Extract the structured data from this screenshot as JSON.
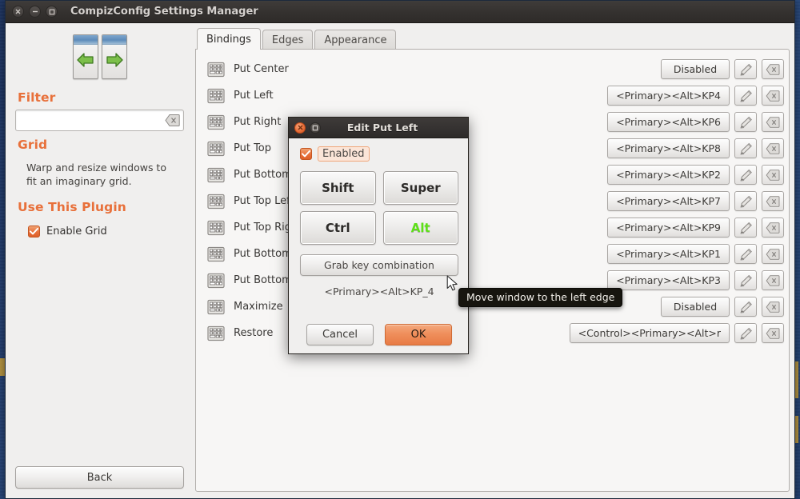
{
  "window": {
    "title": "CompizConfig Settings Manager",
    "controls": [
      {
        "name": "close",
        "glyph": "×"
      },
      {
        "name": "minimize",
        "glyph": "−"
      },
      {
        "name": "maximize",
        "glyph": "□"
      }
    ]
  },
  "sidebar": {
    "plugin_icon": "grid-plugin-icon",
    "filter_heading": "Filter",
    "filter_value": "",
    "filter_placeholder": "",
    "filter_clear_icon": "clear-icon",
    "plugin_heading": "Grid",
    "plugin_description": "Warp and resize windows to fit an imaginary grid.",
    "use_plugin_heading": "Use This Plugin",
    "enable_checkbox_label": "Enable Grid",
    "enable_checkbox_checked": true,
    "back_label": "Back"
  },
  "tabs": [
    {
      "label": "Bindings",
      "active": true
    },
    {
      "label": "Edges",
      "active": false
    },
    {
      "label": "Appearance",
      "active": false
    }
  ],
  "bindings": [
    {
      "icon": "keyboard-icon",
      "label": "Put Center",
      "value": "Disabled",
      "edit_icon": "edit-icon",
      "clear_icon": "clear-icon"
    },
    {
      "icon": "keyboard-icon",
      "label": "Put Left",
      "value": "<Primary><Alt>KP4",
      "edit_icon": "edit-icon",
      "clear_icon": "clear-icon"
    },
    {
      "icon": "keyboard-icon",
      "label": "Put Right",
      "value": "<Primary><Alt>KP6",
      "edit_icon": "edit-icon",
      "clear_icon": "clear-icon"
    },
    {
      "icon": "keyboard-icon",
      "label": "Put Top",
      "value": "<Primary><Alt>KP8",
      "edit_icon": "edit-icon",
      "clear_icon": "clear-icon"
    },
    {
      "icon": "keyboard-icon",
      "label": "Put Bottom",
      "value": "<Primary><Alt>KP2",
      "edit_icon": "edit-icon",
      "clear_icon": "clear-icon"
    },
    {
      "icon": "keyboard-icon",
      "label": "Put Top Left",
      "value": "<Primary><Alt>KP7",
      "edit_icon": "edit-icon",
      "clear_icon": "clear-icon"
    },
    {
      "icon": "keyboard-icon",
      "label": "Put Top Right",
      "value": "<Primary><Alt>KP9",
      "edit_icon": "edit-icon",
      "clear_icon": "clear-icon"
    },
    {
      "icon": "keyboard-icon",
      "label": "Put Bottom Left",
      "value": "<Primary><Alt>KP1",
      "edit_icon": "edit-icon",
      "clear_icon": "clear-icon"
    },
    {
      "icon": "keyboard-icon",
      "label": "Put Bottom Right",
      "value": "<Primary><Alt>KP3",
      "edit_icon": "edit-icon",
      "clear_icon": "clear-icon"
    },
    {
      "icon": "keyboard-icon",
      "label": "Maximize",
      "value": "Disabled",
      "edit_icon": "edit-icon",
      "clear_icon": "clear-icon"
    },
    {
      "icon": "keyboard-icon",
      "label": "Restore",
      "value": "<Control><Primary><Alt>r",
      "edit_icon": "edit-icon",
      "clear_icon": "clear-icon"
    }
  ],
  "dialog": {
    "title": "Edit Put Left",
    "close_glyph": "×",
    "maximize_glyph": "□",
    "enabled_label": "Enabled",
    "enabled_checked": true,
    "modifiers": [
      {
        "label": "Shift",
        "active": false
      },
      {
        "label": "Super",
        "active": false
      },
      {
        "label": "Ctrl",
        "active": false
      },
      {
        "label": "Alt",
        "active": true
      }
    ],
    "grab_label": "Grab key combination",
    "combination": "<Primary><Alt>KP_4",
    "cancel_label": "Cancel",
    "ok_label": "OK"
  },
  "tooltip": {
    "text": "Move window to the left edge"
  },
  "colors": {
    "accent_orange": "#e8703a",
    "active_modifier_green": "#5ee018",
    "window_bg": "#f0efee",
    "panel_bg": "#f7f6f5",
    "titlebar": "#34312f",
    "desktop": "#24406e"
  }
}
